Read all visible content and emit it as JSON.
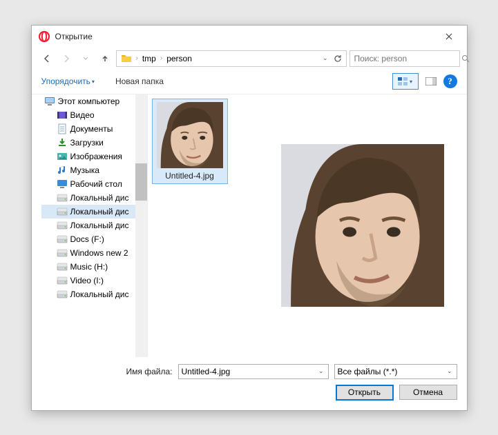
{
  "window": {
    "title": "Открытие"
  },
  "breadcrumb": {
    "items": [
      "tmp",
      "person"
    ]
  },
  "search": {
    "placeholder": "Поиск: person"
  },
  "toolbar": {
    "organize": "Упорядочить",
    "newfolder": "Новая папка"
  },
  "tree": {
    "root": "Этот компьютер",
    "items": [
      {
        "label": "Видео",
        "icon": "video"
      },
      {
        "label": "Документы",
        "icon": "doc"
      },
      {
        "label": "Загрузки",
        "icon": "download"
      },
      {
        "label": "Изображения",
        "icon": "images"
      },
      {
        "label": "Музыка",
        "icon": "music"
      },
      {
        "label": "Рабочий стол",
        "icon": "desktop"
      },
      {
        "label": "Локальный дис",
        "icon": "drive"
      },
      {
        "label": "Локальный дис",
        "icon": "drive",
        "selected": true
      },
      {
        "label": "Локальный дис",
        "icon": "drive"
      },
      {
        "label": "Docs (F:)",
        "icon": "drive"
      },
      {
        "label": "Windows new 2",
        "icon": "drive"
      },
      {
        "label": "Music (H:)",
        "icon": "drive"
      },
      {
        "label": "Video (I:)",
        "icon": "drive"
      },
      {
        "label": "Локальный дис",
        "icon": "drive"
      }
    ]
  },
  "files": [
    {
      "name": "Untitled-4.jpg"
    }
  ],
  "footer": {
    "filename_label": "Имя файла:",
    "filename_value": "Untitled-4.jpg",
    "filter": "Все файлы (*.*)",
    "open": "Открыть",
    "cancel": "Отмена"
  }
}
